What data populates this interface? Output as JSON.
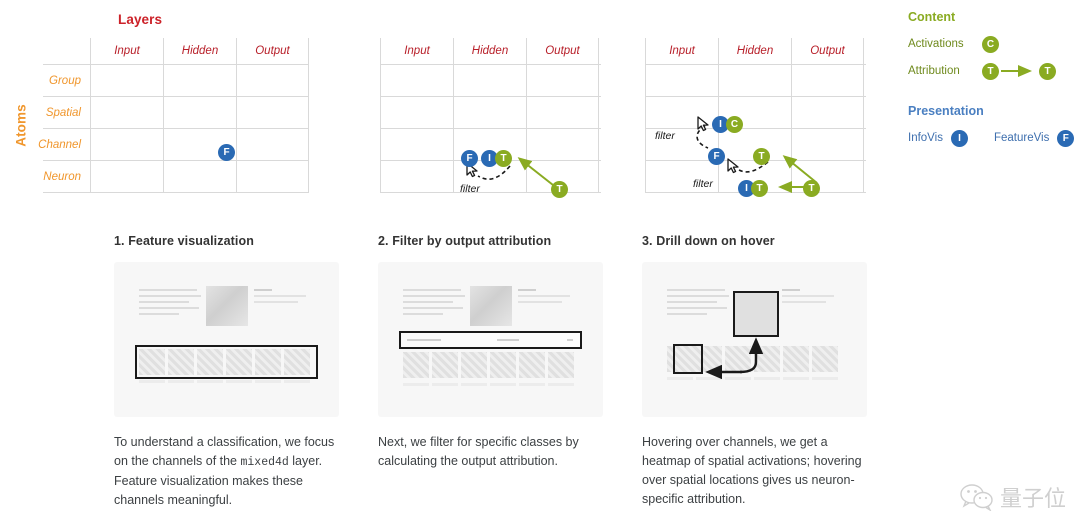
{
  "axis": {
    "columns_title": "Layers",
    "rows_title": "Atoms",
    "columns": [
      "Input",
      "Hidden",
      "Output"
    ],
    "rows": [
      "Group",
      "Spatial",
      "Channel",
      "Neuron"
    ]
  },
  "colors": {
    "columns_title": "#cc2229",
    "rows_title": "#f0962c",
    "column_header": "#b8202a",
    "row_label": "#f0962c",
    "blue_badge": "#2a6ab4",
    "green_badge": "#8aab22",
    "content_heading": "#8aab22",
    "presentation_heading": "#4a7fc1",
    "grid_line": "#d9d9d9"
  },
  "matrices": [
    {
      "name": "feature-visualization-matrix",
      "badges": [
        {
          "label": "F",
          "kind": "blue"
        }
      ],
      "filter_labels": []
    },
    {
      "name": "filter-by-output-attribution-matrix",
      "badges": [
        {
          "label": "F",
          "kind": "blue"
        },
        {
          "label": "I",
          "kind": "blue"
        },
        {
          "label": "T",
          "kind": "green"
        },
        {
          "label": "T",
          "kind": "green"
        }
      ],
      "filter_labels": [
        "filter"
      ]
    },
    {
      "name": "drill-down-on-hover-matrix",
      "badges": [
        {
          "label": "I",
          "kind": "blue"
        },
        {
          "label": "C",
          "kind": "green"
        },
        {
          "label": "F",
          "kind": "blue"
        },
        {
          "label": "T",
          "kind": "green"
        },
        {
          "label": "I",
          "kind": "blue"
        },
        {
          "label": "T",
          "kind": "green"
        },
        {
          "label": "T",
          "kind": "green"
        }
      ],
      "filter_labels": [
        "filter",
        "filter"
      ]
    }
  ],
  "legend": {
    "content": {
      "heading": "Content",
      "items": [
        {
          "label": "Activations",
          "badge": "C",
          "kind": "green",
          "arrow": false
        },
        {
          "label": "Attribution",
          "badge": "T",
          "badge2": "T",
          "kind": "green",
          "arrow": true
        }
      ]
    },
    "presentation": {
      "heading": "Presentation",
      "items": [
        {
          "label": "InfoVis",
          "badge": "I",
          "kind": "blue"
        },
        {
          "label": "FeatureVis",
          "badge": "F",
          "kind": "blue"
        }
      ]
    }
  },
  "panels": [
    {
      "heading": "1. Feature visualization",
      "caption_parts": [
        {
          "text": "To understand a classification, we focus on the channels of the "
        },
        {
          "text": "mixed4d",
          "mono": true
        },
        {
          "text": " layer. Feature visualization makes these channels meaningful."
        }
      ],
      "screenshot_name": "feature-visualization-screenshot"
    },
    {
      "heading": "2. Filter by output attribution",
      "caption_parts": [
        {
          "text": "Next, we filter for specific classes by calculating the output attribution."
        }
      ],
      "screenshot_name": "filter-by-attribution-screenshot"
    },
    {
      "heading": "3. Drill down on hover",
      "caption_parts": [
        {
          "text": "Hovering over channels, we get a heatmap of spatial activations; hovering over spatial locations gives us neuron-specific attribution."
        }
      ],
      "screenshot_name": "drill-down-screenshot"
    }
  ],
  "watermark": {
    "text": "量子位"
  }
}
